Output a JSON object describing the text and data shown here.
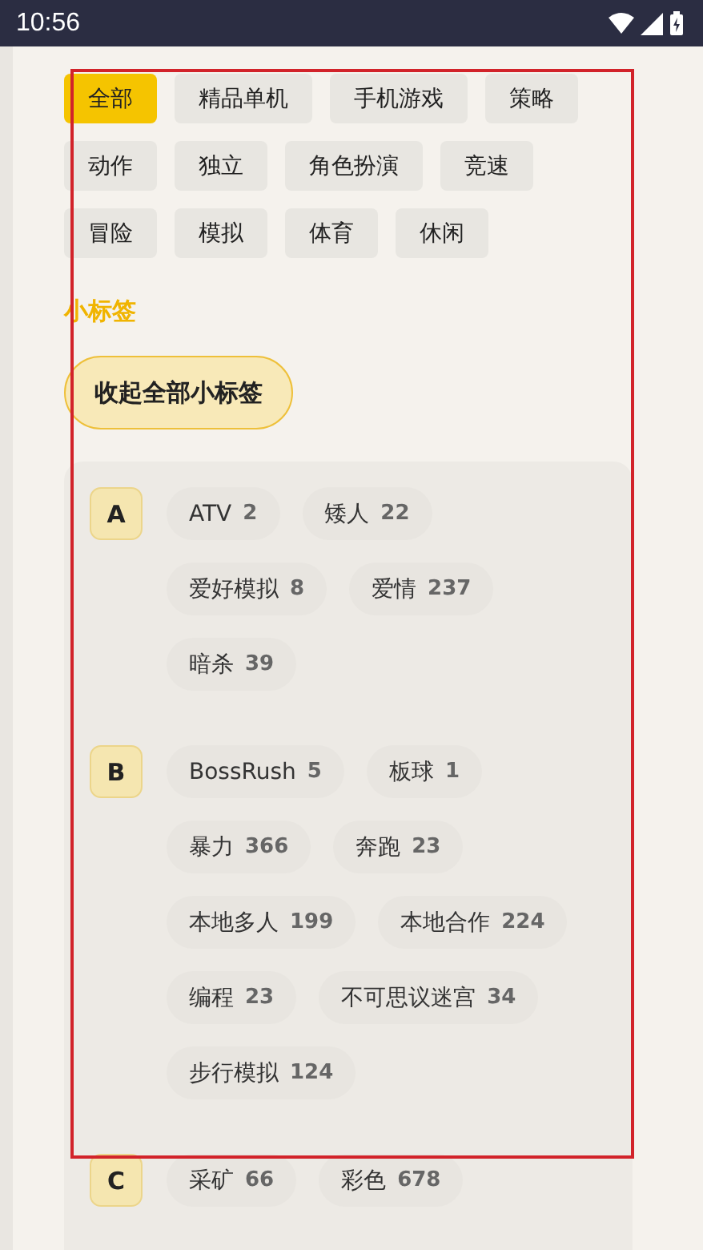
{
  "status_bar": {
    "time": "10:56"
  },
  "categories": [
    {
      "label": "全部",
      "selected": true
    },
    {
      "label": "精品单机",
      "selected": false
    },
    {
      "label": "手机游戏",
      "selected": false
    },
    {
      "label": "策略",
      "selected": false
    },
    {
      "label": "动作",
      "selected": false
    },
    {
      "label": "独立",
      "selected": false
    },
    {
      "label": "角色扮演",
      "selected": false
    },
    {
      "label": "竞速",
      "selected": false
    },
    {
      "label": "冒险",
      "selected": false
    },
    {
      "label": "模拟",
      "selected": false
    },
    {
      "label": "体育",
      "selected": false
    },
    {
      "label": "休闲",
      "selected": false
    }
  ],
  "section_title": "小标签",
  "collapse_button": "收起全部小标签",
  "tag_groups": [
    {
      "letter": "A",
      "tags": [
        {
          "name": "ATV",
          "count": "2"
        },
        {
          "name": "矮人",
          "count": "22"
        },
        {
          "name": "爱好模拟",
          "count": "8"
        },
        {
          "name": "爱情",
          "count": "237"
        },
        {
          "name": "暗杀",
          "count": "39"
        }
      ]
    },
    {
      "letter": "B",
      "tags": [
        {
          "name": "BossRush",
          "count": "5"
        },
        {
          "name": "板球",
          "count": "1"
        },
        {
          "name": "暴力",
          "count": "366"
        },
        {
          "name": "奔跑",
          "count": "23"
        },
        {
          "name": "本地多人",
          "count": "199"
        },
        {
          "name": "本地合作",
          "count": "224"
        },
        {
          "name": "编程",
          "count": "23"
        },
        {
          "name": "不可思议迷宫",
          "count": "34"
        },
        {
          "name": "步行模拟",
          "count": "124"
        }
      ]
    },
    {
      "letter": "C",
      "tags": [
        {
          "name": "采矿",
          "count": "66"
        },
        {
          "name": "彩色",
          "count": "678"
        }
      ]
    }
  ]
}
